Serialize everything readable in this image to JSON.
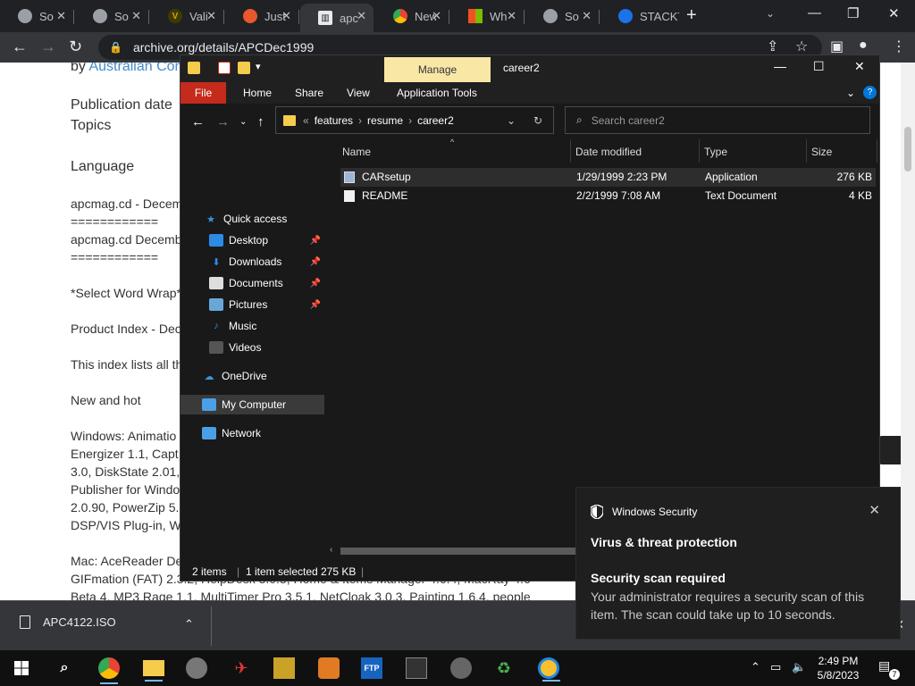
{
  "browser": {
    "tabs": [
      {
        "label": "So",
        "favicon": "globe-icon",
        "color": "#9aa0a6"
      },
      {
        "label": "So",
        "favicon": "globe-icon",
        "color": "#9aa0a6"
      },
      {
        "label": "Vali",
        "favicon": "v-logo-icon",
        "color": "#d4a017"
      },
      {
        "label": "Just",
        "favicon": "just-logo-icon",
        "color": "#e8572d"
      },
      {
        "label": "apc",
        "favicon": "archive-icon",
        "color": "#e8eaed"
      },
      {
        "label": "New",
        "favicon": "chrome-icon",
        "color": "#e8eaed"
      },
      {
        "label": "Wh",
        "favicon": "windows-logo-icon",
        "color": "#f25022"
      },
      {
        "label": "So",
        "favicon": "globe-icon",
        "color": "#9aa0a6"
      },
      {
        "label": "STACKT",
        "favicon": "stack-icon",
        "color": "#1a73e8"
      }
    ],
    "url": "archive.org/details/APCDec1999"
  },
  "webpage": {
    "by_prefix": "by",
    "by_link": "Australian Con",
    "publication_date_label": "Publication date",
    "topics_label": "Topics",
    "language_label": "Language",
    "lines": [
      "apcmag.cd - Decem",
      "============",
      "apcmag.cd Decemb",
      "============",
      "*Select Word Wrap*",
      "Product Index - Dec",
      "This index lists all th",
      "New and hot",
      "Windows: Animatio",
      "Energizer 1.1, Capt",
      "3.0, DiskState 2.01,",
      "Publisher for Windo",
      "2.0.90, PowerZip 5.",
      "DSP/VIS Plug-in, W",
      "Mac: AceReader De",
      "GIFmation (FAT) 2.3.2, HelpDesk 3.0.3, Home & Items Manager 4.6.4, MacRay 4.6",
      "Beta 4, MP3 Rage 1.1, MultiTimer Pro 3.5.1, NetCloak 3.0.3, Painting 1.6.4, people"
    ]
  },
  "explorer": {
    "manage_label": "Manage",
    "title": "career2",
    "ribbon": {
      "file": "File",
      "home": "Home",
      "share": "Share",
      "view": "View",
      "app_tools": "Application Tools"
    },
    "breadcrumb": [
      "features",
      "resume",
      "career2"
    ],
    "search_placeholder": "Search career2",
    "nav": {
      "quick_access": "Quick access",
      "desktop": "Desktop",
      "downloads": "Downloads",
      "documents": "Documents",
      "pictures": "Pictures",
      "music": "Music",
      "videos": "Videos",
      "onedrive": "OneDrive",
      "my_computer": "My Computer",
      "network": "Network"
    },
    "columns": {
      "name": "Name",
      "date": "Date modified",
      "type": "Type",
      "size": "Size"
    },
    "files": [
      {
        "name": "CARsetup",
        "date": "1/29/1999 2:23 PM",
        "type": "Application",
        "size": "276 KB"
      },
      {
        "name": "README",
        "date": "2/2/1999 7:08 AM",
        "type": "Text Document",
        "size": "4 KB"
      }
    ],
    "status": {
      "items": "2 items",
      "selected": "1 item selected",
      "size": "275 KB"
    }
  },
  "downloads": {
    "file": "APC4122.ISO"
  },
  "toast": {
    "app": "Windows Security",
    "title": "Virus & threat protection",
    "heading": "Security scan required",
    "body": "Your administrator requires a security scan of this item. The scan could take up to 10 seconds."
  },
  "taskbar": {
    "time": "2:49 PM",
    "date": "5/8/2023",
    "notification_count": "7",
    "ftp_label": "FTP"
  }
}
